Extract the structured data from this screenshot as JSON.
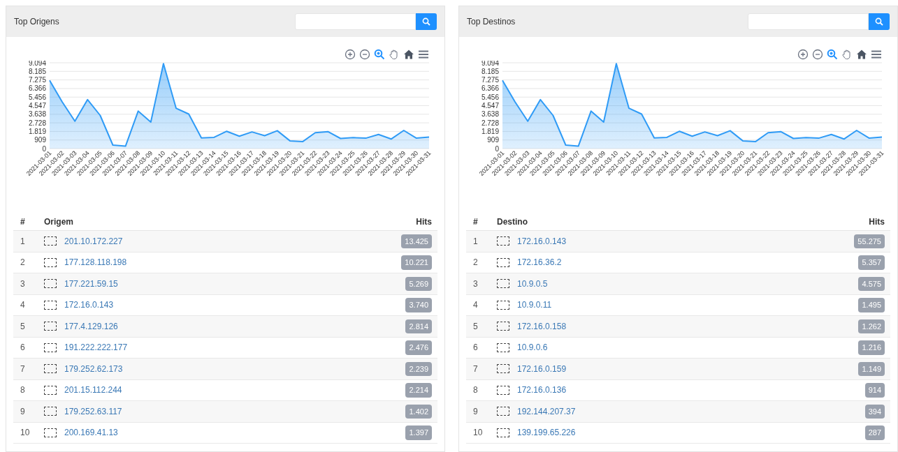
{
  "panels": [
    {
      "title": "Top Origens",
      "chart_data": {
        "type": "area",
        "categories": [
          "2021-03-01",
          "2021-03-02",
          "2021-03-03",
          "2021-03-04",
          "2021-03-05",
          "2021-03-06",
          "2021-03-07",
          "2021-03-08",
          "2021-03-09",
          "2021-03-10",
          "2021-03-11",
          "2021-03-12",
          "2021-03-13",
          "2021-03-14",
          "2021-03-15",
          "2021-03-16",
          "2021-03-17",
          "2021-03-18",
          "2021-03-19",
          "2021-03-20",
          "2021-03-21",
          "2021-03-22",
          "2021-03-23",
          "2021-03-24",
          "2021-03-25",
          "2021-03-26",
          "2021-03-27",
          "2021-03-28",
          "2021-03-29",
          "2021-03-30",
          "2021-03-31"
        ],
        "series": [
          {
            "color": "#2f9bf6",
            "values": [
              7230,
              4940,
              2900,
              5190,
              3510,
              370,
              250,
              3970,
              2810,
              9000,
              4270,
              3660,
              1130,
              1190,
              1830,
              1310,
              1770,
              1370,
              1890,
              820,
              730,
              1680,
              1800,
              1070,
              1160,
              1100,
              1490,
              1010,
              1920,
              1100,
              1220
            ]
          }
        ],
        "ylim": [
          0,
          9094
        ],
        "grid": true,
        "yticks": [
          {
            "value": 0,
            "label": "0"
          },
          {
            "value": 909,
            "label": "909"
          },
          {
            "value": 1819,
            "label": "1.819"
          },
          {
            "value": 2728,
            "label": "2.728"
          },
          {
            "value": 3638,
            "label": "3.638"
          },
          {
            "value": 4547,
            "label": "4.547"
          },
          {
            "value": 5456,
            "label": "5.456"
          },
          {
            "value": 6366,
            "label": "6.366"
          },
          {
            "value": 7275,
            "label": "7.275"
          },
          {
            "value": 8185,
            "label": "8.185"
          },
          {
            "value": 9094,
            "label": "9.094"
          }
        ]
      },
      "table": {
        "columns": [
          "#",
          "Origem",
          "Hits"
        ],
        "rows": [
          {
            "rank": "1",
            "address": "201.10.172.227",
            "hits": "13.425"
          },
          {
            "rank": "2",
            "address": "177.128.118.198",
            "hits": "10.221"
          },
          {
            "rank": "3",
            "address": "177.221.59.15",
            "hits": "5.269"
          },
          {
            "rank": "4",
            "address": "172.16.0.143",
            "hits": "3.740"
          },
          {
            "rank": "5",
            "address": "177.4.129.126",
            "hits": "2.814"
          },
          {
            "rank": "6",
            "address": "191.222.222.177",
            "hits": "2.476"
          },
          {
            "rank": "7",
            "address": "179.252.62.173",
            "hits": "2.239"
          },
          {
            "rank": "8",
            "address": "201.15.112.244",
            "hits": "2.214"
          },
          {
            "rank": "9",
            "address": "179.252.63.117",
            "hits": "1.402"
          },
          {
            "rank": "10",
            "address": "200.169.41.13",
            "hits": "1.397"
          }
        ]
      }
    },
    {
      "title": "Top Destinos",
      "chart_data": {
        "type": "area",
        "categories": [
          "2021-03-01",
          "2021-03-02",
          "2021-03-03",
          "2021-03-04",
          "2021-03-05",
          "2021-03-06",
          "2021-03-07",
          "2021-03-08",
          "2021-03-09",
          "2021-03-10",
          "2021-03-11",
          "2021-03-12",
          "2021-03-13",
          "2021-03-14",
          "2021-03-15",
          "2021-03-16",
          "2021-03-17",
          "2021-03-18",
          "2021-03-19",
          "2021-03-20",
          "2021-03-21",
          "2021-03-22",
          "2021-03-23",
          "2021-03-24",
          "2021-03-25",
          "2021-03-26",
          "2021-03-27",
          "2021-03-28",
          "2021-03-29",
          "2021-03-30",
          "2021-03-31"
        ],
        "series": [
          {
            "color": "#2f9bf6",
            "values": [
              7230,
              4940,
              2900,
              5190,
              3510,
              370,
              250,
              3970,
              2810,
              9000,
              4270,
              3660,
              1130,
              1190,
              1830,
              1310,
              1770,
              1370,
              1890,
              820,
              730,
              1680,
              1800,
              1070,
              1160,
              1100,
              1490,
              1010,
              1920,
              1100,
              1220
            ]
          }
        ],
        "ylim": [
          0,
          9094
        ],
        "grid": true,
        "yticks": [
          {
            "value": 0,
            "label": "0"
          },
          {
            "value": 909,
            "label": "909"
          },
          {
            "value": 1819,
            "label": "1.819"
          },
          {
            "value": 2728,
            "label": "2.728"
          },
          {
            "value": 3638,
            "label": "3.638"
          },
          {
            "value": 4547,
            "label": "4.547"
          },
          {
            "value": 5456,
            "label": "5.456"
          },
          {
            "value": 6366,
            "label": "6.366"
          },
          {
            "value": 7275,
            "label": "7.275"
          },
          {
            "value": 8185,
            "label": "8.185"
          },
          {
            "value": 9094,
            "label": "9.094"
          }
        ]
      },
      "table": {
        "columns": [
          "#",
          "Destino",
          "Hits"
        ],
        "rows": [
          {
            "rank": "1",
            "address": "172.16.0.143",
            "hits": "55.275"
          },
          {
            "rank": "2",
            "address": "172.16.36.2",
            "hits": "5.357"
          },
          {
            "rank": "3",
            "address": "10.9.0.5",
            "hits": "4.575"
          },
          {
            "rank": "4",
            "address": "10.9.0.11",
            "hits": "1.495"
          },
          {
            "rank": "5",
            "address": "172.16.0.158",
            "hits": "1.262"
          },
          {
            "rank": "6",
            "address": "10.9.0.6",
            "hits": "1.216"
          },
          {
            "rank": "7",
            "address": "172.16.0.159",
            "hits": "1.149"
          },
          {
            "rank": "8",
            "address": "172.16.0.136",
            "hits": "914"
          },
          {
            "rank": "9",
            "address": "192.144.207.37",
            "hits": "394"
          },
          {
            "rank": "10",
            "address": "139.199.65.226",
            "hits": "287"
          }
        ]
      }
    }
  ]
}
